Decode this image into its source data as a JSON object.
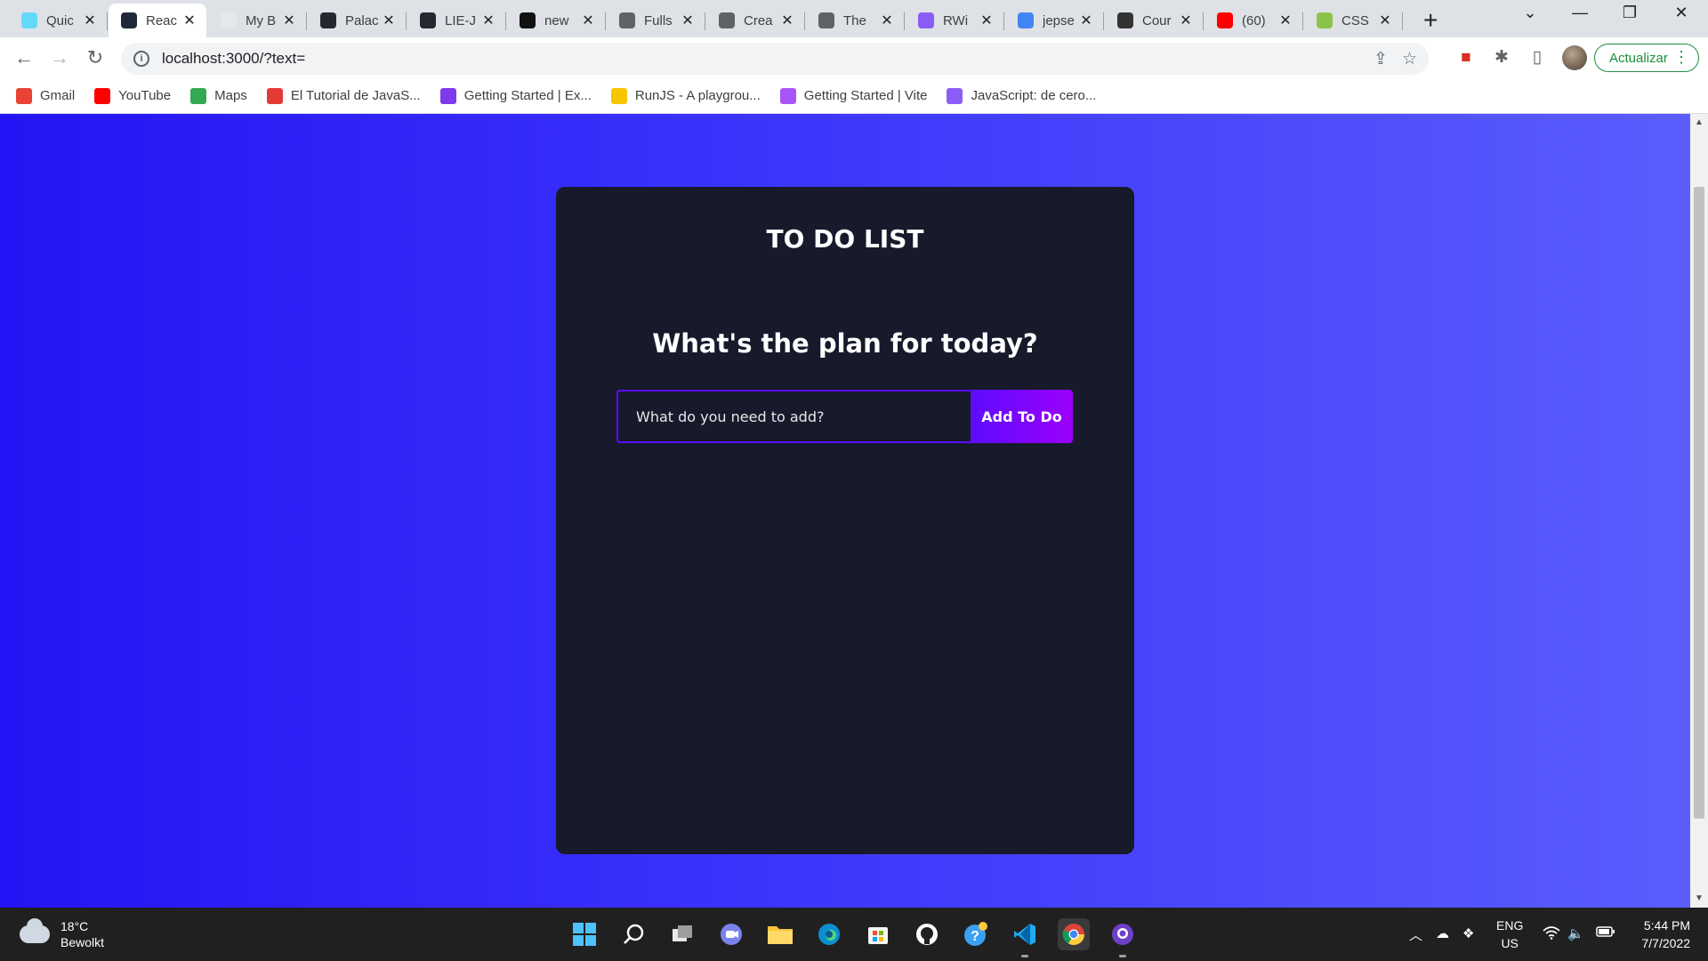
{
  "browser": {
    "tabs": [
      {
        "title": "Quic",
        "icon": "react-icon",
        "color": "#61dafb",
        "active": false
      },
      {
        "title": "Reac",
        "icon": "react-icon",
        "color": "#1f2937",
        "active": true
      },
      {
        "title": "My B",
        "icon": "behance-icon",
        "color": "#e5e7eb",
        "active": false
      },
      {
        "title": "Palac",
        "icon": "github-icon",
        "color": "#24292f",
        "active": false
      },
      {
        "title": "LIE-J",
        "icon": "github-icon",
        "color": "#24292f",
        "active": false
      },
      {
        "title": "new",
        "icon": "nc-icon",
        "color": "#111111",
        "active": false
      },
      {
        "title": "Fulls",
        "icon": "square-icon",
        "color": "#5f6368",
        "active": false
      },
      {
        "title": "Crea",
        "icon": "glasses-icon",
        "color": "#5f6368",
        "active": false
      },
      {
        "title": "The",
        "icon": "mask-icon",
        "color": "#5f6368",
        "active": false
      },
      {
        "title": "RWi",
        "icon": "info-icon",
        "color": "#8b5cf6",
        "active": false
      },
      {
        "title": "jepse",
        "icon": "chrome-badge-icon",
        "color": "#4285f4",
        "active": false
      },
      {
        "title": "Cour",
        "icon": "course-icon",
        "color": "#333333",
        "active": false
      },
      {
        "title": "(60)",
        "icon": "youtube-icon",
        "color": "#ff0000",
        "active": false
      },
      {
        "title": "CSS",
        "icon": "css-star-icon",
        "color": "#8bc34a",
        "active": false
      }
    ],
    "url": "localhost:3000/?text=",
    "update_label": "Actualizar",
    "bookmarks": [
      {
        "label": "Gmail",
        "icon": "gmail-icon",
        "color": "#ea4335"
      },
      {
        "label": "YouTube",
        "icon": "youtube-icon",
        "color": "#ff0000"
      },
      {
        "label": "Maps",
        "icon": "maps-icon",
        "color": "#34a853"
      },
      {
        "label": "El Tutorial de JavaS...",
        "icon": "tutorial-icon",
        "color": "#e53935"
      },
      {
        "label": "Getting Started | Ex...",
        "icon": "braces-icon",
        "color": "#7c3aed"
      },
      {
        "label": "RunJS - A playgrou...",
        "icon": "runjs-icon",
        "color": "#f7c600"
      },
      {
        "label": "Getting Started | Vite",
        "icon": "vite-icon",
        "color": "#a855f7"
      },
      {
        "label": "JavaScript: de cero...",
        "icon": "js-course-icon",
        "color": "#8b5cf6"
      }
    ]
  },
  "app": {
    "title": "TO DO LIST",
    "subtitle": "What's the plan for today?",
    "input": {
      "placeholder": "What do you need to add?",
      "value": ""
    },
    "add_button": "Add To Do"
  },
  "taskbar": {
    "weather": {
      "temp": "18°C",
      "condition": "Bewolkt"
    },
    "language": {
      "line1": "ENG",
      "line2": "US"
    },
    "clock": {
      "time": "5:44 PM",
      "date": "7/7/2022"
    }
  }
}
